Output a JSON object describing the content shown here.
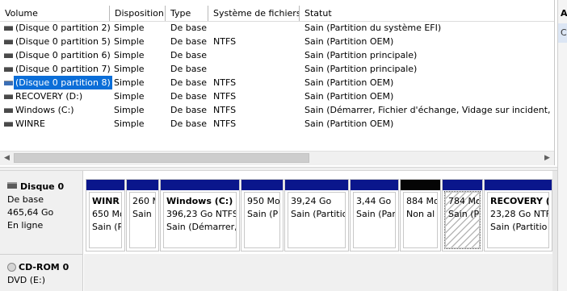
{
  "columns": {
    "volume": "Volume",
    "disposition": "Disposition",
    "type": "Type",
    "fs": "Système de fichiers",
    "status": "Statut"
  },
  "rows": [
    {
      "volume": "(Disque 0 partition 2)",
      "disposition": "Simple",
      "type": "De base",
      "fs": "",
      "status": "Sain (Partition du système EFI)"
    },
    {
      "volume": "(Disque 0 partition 5)",
      "disposition": "Simple",
      "type": "De base",
      "fs": "NTFS",
      "status": "Sain (Partition OEM)"
    },
    {
      "volume": "(Disque 0 partition 6)",
      "disposition": "Simple",
      "type": "De base",
      "fs": "",
      "status": "Sain (Partition principale)"
    },
    {
      "volume": "(Disque 0 partition 7)",
      "disposition": "Simple",
      "type": "De base",
      "fs": "",
      "status": "Sain (Partition principale)"
    },
    {
      "volume": "(Disque 0 partition 8)",
      "disposition": "Simple",
      "type": "De base",
      "fs": "NTFS",
      "status": "Sain (Partition OEM)"
    },
    {
      "volume": "RECOVERY (D:)",
      "disposition": "Simple",
      "type": "De base",
      "fs": "NTFS",
      "status": "Sain (Partition OEM)"
    },
    {
      "volume": "Windows (C:)",
      "disposition": "Simple",
      "type": "De base",
      "fs": "NTFS",
      "status": "Sain (Démarrer, Fichier d'échange, Vidage sur incident, Par"
    },
    {
      "volume": "WINRE",
      "disposition": "Simple",
      "type": "De base",
      "fs": "NTFS",
      "status": "Sain (Partition OEM)"
    }
  ],
  "selected_row": 4,
  "right_pane": {
    "header": "A",
    "item": "C"
  },
  "disk0": {
    "title": "Disque 0",
    "type": "De base",
    "size": "465,64 Go",
    "state": "En ligne"
  },
  "partitions": [
    {
      "name": "WINR",
      "size": "650 Mo",
      "status": "Sain (P"
    },
    {
      "name": "",
      "size": "260 M",
      "status": "Sain ("
    },
    {
      "name": "Windows  (C:)",
      "size": "396,23 Go NTFS",
      "status": "Sain (Démarrer,"
    },
    {
      "name": "",
      "size": "950 Mo",
      "status": "Sain (P"
    },
    {
      "name": "",
      "size": "39,24 Go",
      "status": "Sain (Partitio"
    },
    {
      "name": "",
      "size": "3,44 Go",
      "status": "Sain (Par"
    },
    {
      "name": "",
      "size": "884 Mo",
      "status": "Non al"
    },
    {
      "name": "",
      "size": "784 Mo",
      "status": "Sain (P"
    },
    {
      "name": "RECOVERY  (",
      "size": "23,28 Go NTF",
      "status": "Sain (Partitio"
    }
  ],
  "cdrom": {
    "title": "CD-ROM 0",
    "drive": "DVD (E:)"
  },
  "colors": {
    "partition_bar": "#0a168c",
    "unallocated_bar": "#050505",
    "selection": "#0b6ed8"
  }
}
